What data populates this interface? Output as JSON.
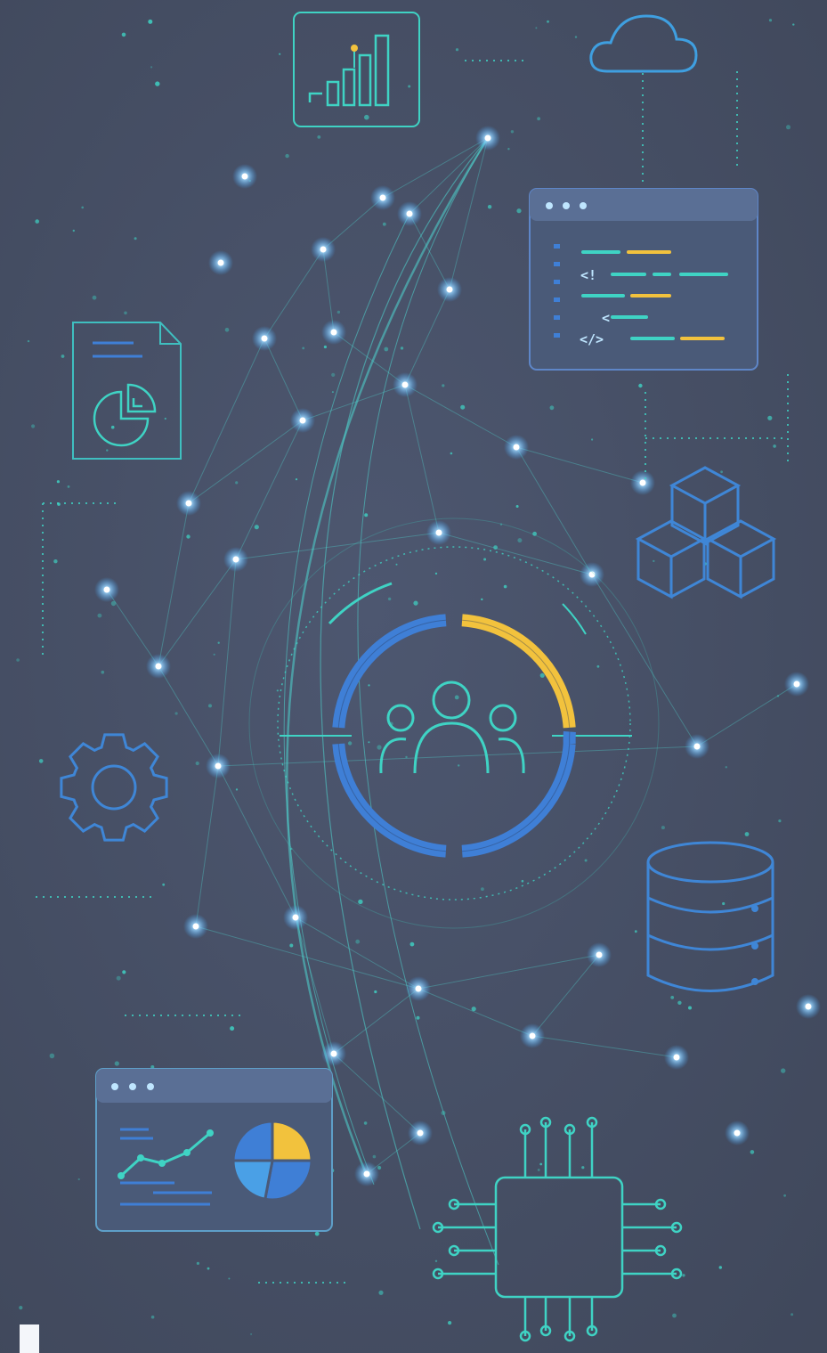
{
  "illustration": {
    "code_window": {
      "tag_open": "<!",
      "tag_lt": "<",
      "tag_code": "</>"
    },
    "colors": {
      "background": "#454e63",
      "teal": "#3fd3c4",
      "blue": "#3f7fd6",
      "yellow": "#f2c23d",
      "node_glow": "#7ec8ff"
    },
    "icons": [
      "bar-chart-icon",
      "cloud-icon",
      "code-window-icon",
      "document-pie-icon",
      "cubes-icon",
      "gear-icon",
      "database-icon",
      "dashboard-window-icon",
      "chip-icon",
      "team-icon"
    ],
    "ring_progress": 0.25
  }
}
